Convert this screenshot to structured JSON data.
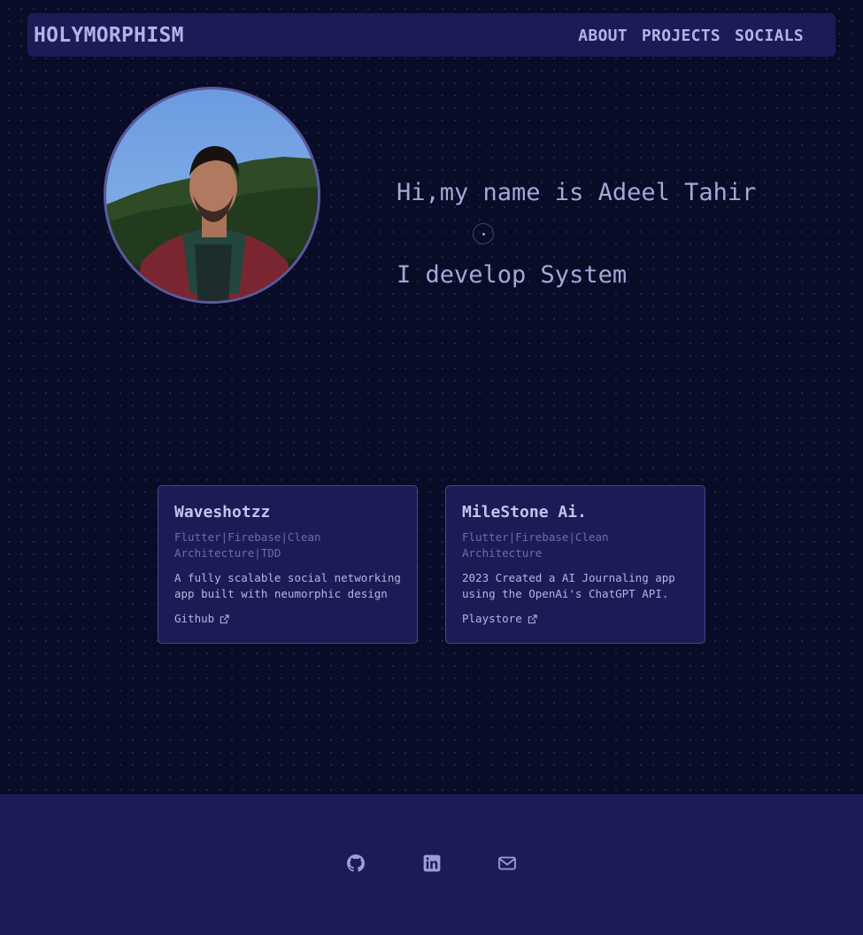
{
  "header": {
    "logo": "HOLYMORPHISM",
    "nav": [
      "ABOUT",
      "PROJECTS",
      "SOCIALS"
    ]
  },
  "hero": {
    "line1": "Hi,my name is Adeel Tahir",
    "line2": "I develop System",
    "avatar": "profile-photo"
  },
  "projects": [
    {
      "title": "Waveshotzz",
      "tags": "Flutter|Firebase|Clean Architecture|TDD",
      "description": "A fully scalable social networking app built with neumorphic design",
      "link_label": "Github",
      "link_icon": "external-link-icon"
    },
    {
      "title": "MileStone Ai.",
      "tags": "Flutter|Firebase|Clean Architecture",
      "description": "2023 Created a AI Journaling app using the OpenAi's ChatGPT API.",
      "link_label": "Playstore",
      "link_icon": "external-link-icon"
    }
  ],
  "footer": {
    "icons": [
      "github-icon",
      "linkedin-icon",
      "mail-icon"
    ]
  },
  "colors": {
    "background": "#080c26",
    "surface": "#1c1b56",
    "text": "#b3b2e8",
    "muted": "#6d6cab",
    "border": "#45488a"
  }
}
